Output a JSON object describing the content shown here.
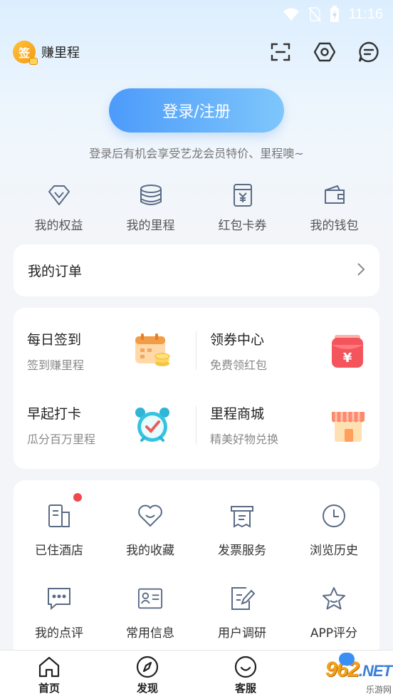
{
  "status": {
    "time": "11:16"
  },
  "header": {
    "earn_label": "赚里程",
    "earn_badge": "签"
  },
  "login": {
    "button_label": "登录/注册",
    "tip": "登录后有机会享受艺龙会员特价、里程噢~"
  },
  "quick": [
    {
      "label": "我的权益",
      "icon": "diamond-icon"
    },
    {
      "label": "我的里程",
      "icon": "coins-icon"
    },
    {
      "label": "红包卡券",
      "icon": "coupon-icon"
    },
    {
      "label": "我的钱包",
      "icon": "wallet-icon"
    }
  ],
  "orders": {
    "title": "我的订单"
  },
  "promos": [
    {
      "title": "每日签到",
      "sub": "签到赚里程",
      "icon": "calendar-icon"
    },
    {
      "title": "领券中心",
      "sub": "免费领红包",
      "icon": "red-envelope-icon"
    },
    {
      "title": "早起打卡",
      "sub": "瓜分百万里程",
      "icon": "alarm-clock-icon"
    },
    {
      "title": "里程商城",
      "sub": "精美好物兑换",
      "icon": "shop-icon"
    }
  ],
  "tools": [
    {
      "label": "已住酒店",
      "icon": "hotel-icon"
    },
    {
      "label": "我的收藏",
      "icon": "heart-icon"
    },
    {
      "label": "发票服务",
      "icon": "invoice-icon"
    },
    {
      "label": "浏览历史",
      "icon": "clock-icon"
    },
    {
      "label": "我的点评",
      "icon": "comment-icon"
    },
    {
      "label": "常用信息",
      "icon": "id-card-icon"
    },
    {
      "label": "用户调研",
      "icon": "survey-icon"
    },
    {
      "label": "APP评分",
      "icon": "star-icon"
    }
  ],
  "tabs": [
    {
      "label": "首页",
      "icon": "home-icon"
    },
    {
      "label": "发现",
      "icon": "compass-icon"
    },
    {
      "label": "客服",
      "icon": "service-icon"
    }
  ],
  "watermark": {
    "logo": "962",
    "net": ".NET",
    "sub": "乐游网"
  },
  "colors": {
    "accent": "#4c9bfb",
    "icon_line": "#5a6b86",
    "badge_red": "#f0484e"
  }
}
